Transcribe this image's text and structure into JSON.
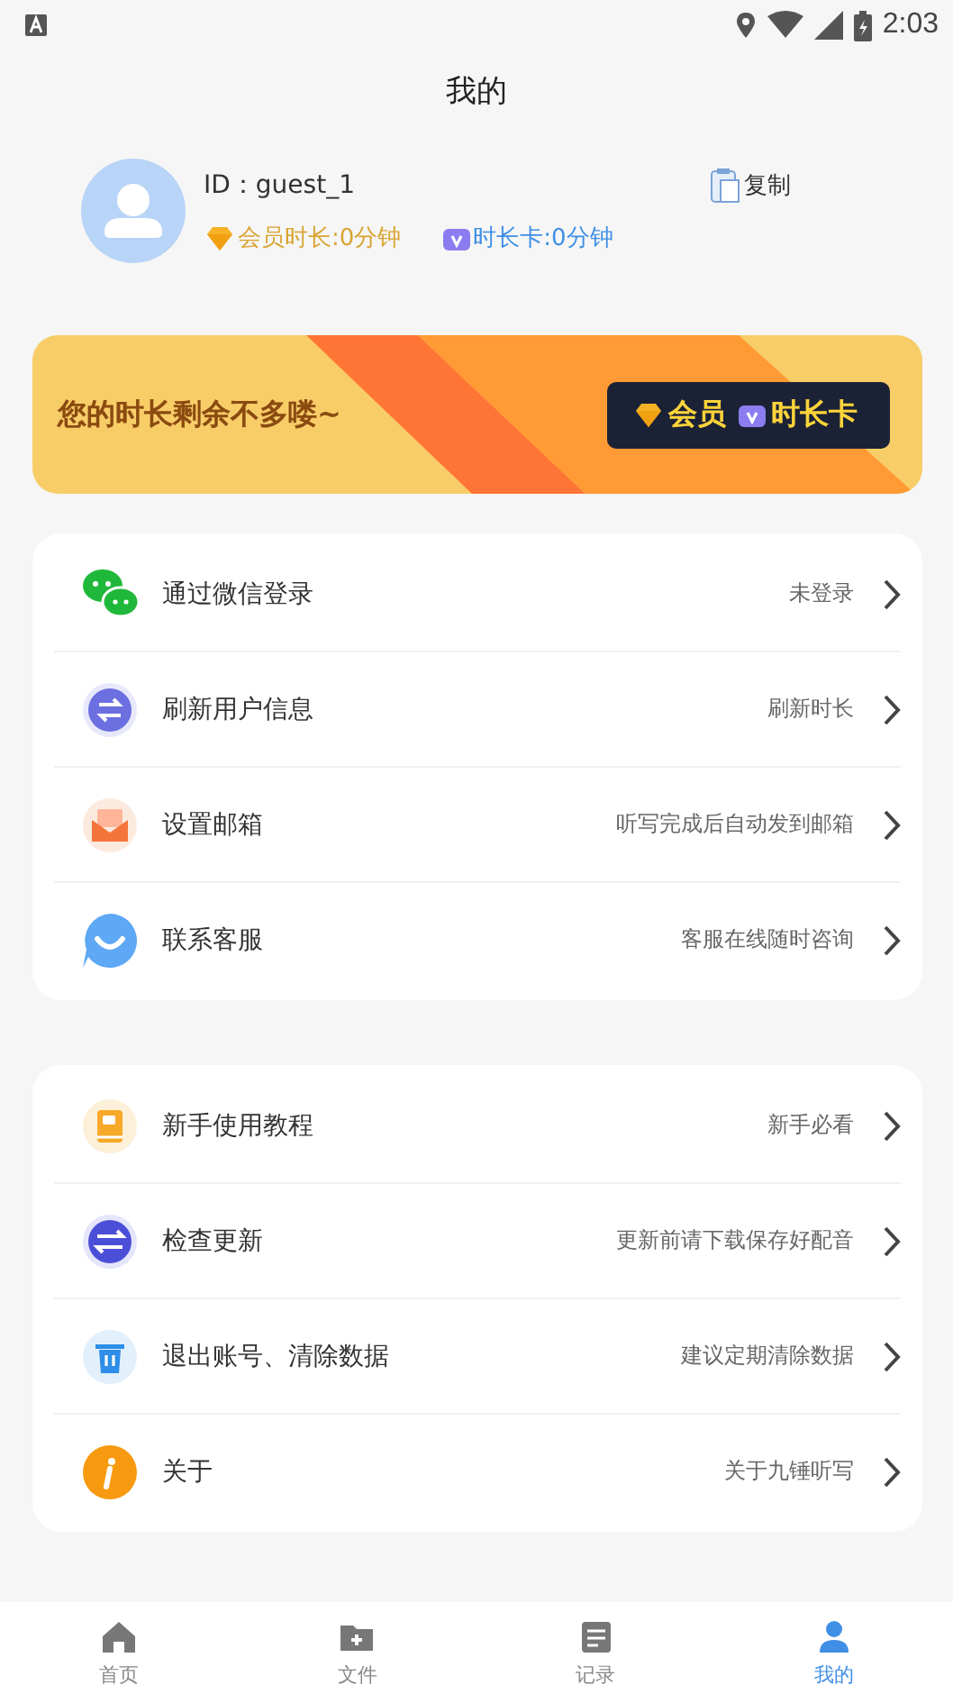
{
  "status_bar": {
    "time": "2:03"
  },
  "header": {
    "title": "我的"
  },
  "profile": {
    "id": "ID：guest_1",
    "copy": "复制",
    "member": "会员时长:0分钟",
    "card": "时长卡:0分钟"
  },
  "banner": {
    "message": "您的时长剩余不多喽~",
    "member": "会员",
    "card": "时长卡"
  },
  "groups": [
    {
      "items": [
        {
          "label": "通过微信登录",
          "hint": "未登录"
        },
        {
          "label": "刷新用户信息",
          "hint": "刷新时长"
        },
        {
          "label": "设置邮箱",
          "hint": "听写完成后自动发到邮箱"
        },
        {
          "label": "联系客服",
          "hint": "客服在线随时咨询"
        }
      ]
    },
    {
      "items": [
        {
          "label": "新手使用教程",
          "hint": "新手必看"
        },
        {
          "label": "检查更新",
          "hint": "更新前请下载保存好配音"
        },
        {
          "label": "退出账号、清除数据",
          "hint": "建议定期清除数据"
        },
        {
          "label": "关于",
          "hint": "关于九锤听写"
        }
      ]
    }
  ],
  "tabs": [
    {
      "label": "首页",
      "selected": false
    },
    {
      "label": "文件",
      "selected": false
    },
    {
      "label": "记录",
      "selected": false
    },
    {
      "label": "我的",
      "selected": true
    }
  ]
}
